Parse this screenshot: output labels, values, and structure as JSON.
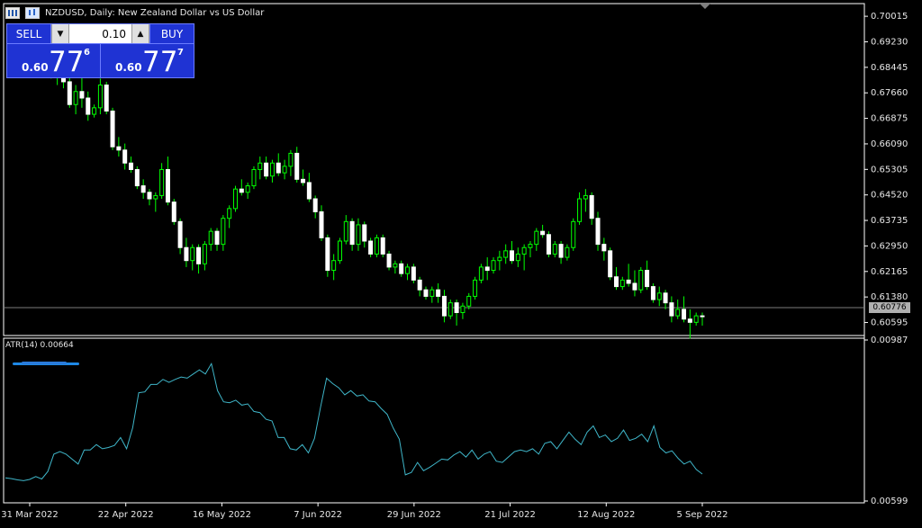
{
  "window": {
    "title": "NZDUSD, Daily:  New Zealand Dollar vs US Dollar",
    "icons": [
      "grid-icon",
      "ohlc-icon"
    ]
  },
  "trade_panel": {
    "sell_label": "SELL",
    "buy_label": "BUY",
    "lot_value": "0.10",
    "lot_down": "▼",
    "lot_up": "▲",
    "sell_price": {
      "prefix": "0.60",
      "main": "77",
      "sup": "6"
    },
    "buy_price": {
      "prefix": "0.60",
      "main": "77",
      "sup": "7"
    }
  },
  "indicator": {
    "label": "ATR(14) 0.00664",
    "axis_labels": [
      "0.00987",
      "0.00599"
    ]
  },
  "price_axis": {
    "labels": [
      "0.70015",
      "0.69230",
      "0.68445",
      "0.67660",
      "0.66875",
      "0.66090",
      "0.65305",
      "0.64520",
      "0.63735",
      "0.62950",
      "0.62165",
      "0.61380",
      "0.60595"
    ],
    "last_price": "0.60776"
  },
  "time_axis": {
    "labels": [
      "31 Mar 2022",
      "22 Apr 2022",
      "16 May 2022",
      "7 Jun 2022",
      "29 Jun 2022",
      "21 Jul 2022",
      "12 Aug 2022",
      "5 Sep 2022"
    ]
  },
  "colors": {
    "background": "#000000",
    "candle": "#00ff00",
    "grid": "#ffffff",
    "atr_line": "#3fb6c9",
    "panel_blue": "#1f33d3"
  },
  "chart_data": [
    {
      "type": "candlestick",
      "title": "NZDUSD, Daily:  New Zealand Dollar vs US Dollar",
      "ylim": [
        0.6025,
        0.7035
      ],
      "candles": [
        [
          0.69,
          0.693,
          0.684,
          0.687
        ],
        [
          0.687,
          0.69,
          0.681,
          0.684
        ],
        [
          0.684,
          0.687,
          0.679,
          0.682
        ],
        [
          0.682,
          0.686,
          0.678,
          0.68
        ],
        [
          0.68,
          0.682,
          0.672,
          0.673
        ],
        [
          0.673,
          0.679,
          0.67,
          0.677
        ],
        [
          0.677,
          0.683,
          0.672,
          0.675
        ],
        [
          0.675,
          0.677,
          0.668,
          0.67
        ],
        [
          0.67,
          0.673,
          0.669,
          0.672
        ],
        [
          0.672,
          0.681,
          0.67,
          0.679
        ],
        [
          0.679,
          0.68,
          0.67,
          0.671
        ],
        [
          0.671,
          0.672,
          0.659,
          0.66
        ],
        [
          0.66,
          0.663,
          0.657,
          0.659
        ],
        [
          0.659,
          0.661,
          0.653,
          0.655
        ],
        [
          0.655,
          0.657,
          0.652,
          0.653
        ],
        [
          0.653,
          0.654,
          0.647,
          0.648
        ],
        [
          0.648,
          0.65,
          0.644,
          0.646
        ],
        [
          0.646,
          0.647,
          0.642,
          0.644
        ],
        [
          0.644,
          0.646,
          0.64,
          0.645
        ],
        [
          0.645,
          0.655,
          0.644,
          0.653
        ],
        [
          0.653,
          0.657,
          0.642,
          0.643
        ],
        [
          0.643,
          0.644,
          0.636,
          0.637
        ],
        [
          0.637,
          0.638,
          0.627,
          0.629
        ],
        [
          0.629,
          0.632,
          0.623,
          0.625
        ],
        [
          0.625,
          0.63,
          0.622,
          0.629
        ],
        [
          0.629,
          0.63,
          0.621,
          0.624
        ],
        [
          0.624,
          0.631,
          0.622,
          0.63
        ],
        [
          0.63,
          0.635,
          0.628,
          0.634
        ],
        [
          0.634,
          0.635,
          0.628,
          0.63
        ],
        [
          0.63,
          0.639,
          0.628,
          0.638
        ],
        [
          0.638,
          0.642,
          0.635,
          0.641
        ],
        [
          0.641,
          0.648,
          0.64,
          0.647
        ],
        [
          0.647,
          0.65,
          0.645,
          0.646
        ],
        [
          0.646,
          0.649,
          0.644,
          0.648
        ],
        [
          0.648,
          0.654,
          0.647,
          0.653
        ],
        [
          0.653,
          0.657,
          0.65,
          0.655
        ],
        [
          0.655,
          0.657,
          0.65,
          0.651
        ],
        [
          0.651,
          0.656,
          0.649,
          0.655
        ],
        [
          0.655,
          0.658,
          0.651,
          0.652
        ],
        [
          0.652,
          0.656,
          0.65,
          0.654
        ],
        [
          0.654,
          0.659,
          0.651,
          0.658
        ],
        [
          0.658,
          0.66,
          0.649,
          0.65
        ],
        [
          0.65,
          0.653,
          0.648,
          0.649
        ],
        [
          0.649,
          0.652,
          0.643,
          0.644
        ],
        [
          0.644,
          0.645,
          0.638,
          0.64
        ],
        [
          0.64,
          0.642,
          0.631,
          0.632
        ],
        [
          0.632,
          0.633,
          0.62,
          0.622
        ],
        [
          0.622,
          0.627,
          0.619,
          0.625
        ],
        [
          0.625,
          0.632,
          0.624,
          0.631
        ],
        [
          0.631,
          0.639,
          0.63,
          0.637
        ],
        [
          0.637,
          0.638,
          0.628,
          0.63
        ],
        [
          0.63,
          0.638,
          0.628,
          0.636
        ],
        [
          0.636,
          0.637,
          0.629,
          0.631
        ],
        [
          0.631,
          0.632,
          0.626,
          0.627
        ],
        [
          0.627,
          0.633,
          0.626,
          0.632
        ],
        [
          0.632,
          0.633,
          0.626,
          0.627
        ],
        [
          0.627,
          0.628,
          0.622,
          0.623
        ],
        [
          0.623,
          0.625,
          0.621,
          0.624
        ],
        [
          0.624,
          0.625,
          0.62,
          0.621
        ],
        [
          0.621,
          0.624,
          0.619,
          0.623
        ],
        [
          0.623,
          0.624,
          0.618,
          0.619
        ],
        [
          0.619,
          0.62,
          0.614,
          0.616
        ],
        [
          0.616,
          0.617,
          0.613,
          0.614
        ],
        [
          0.614,
          0.617,
          0.612,
          0.616
        ],
        [
          0.616,
          0.618,
          0.612,
          0.614
        ],
        [
          0.614,
          0.616,
          0.606,
          0.608
        ],
        [
          0.608,
          0.613,
          0.607,
          0.612
        ],
        [
          0.612,
          0.613,
          0.605,
          0.609
        ],
        [
          0.609,
          0.612,
          0.607,
          0.611
        ],
        [
          0.611,
          0.615,
          0.61,
          0.614
        ],
        [
          0.614,
          0.62,
          0.613,
          0.619
        ],
        [
          0.619,
          0.624,
          0.618,
          0.623
        ],
        [
          0.623,
          0.626,
          0.619,
          0.622
        ],
        [
          0.622,
          0.626,
          0.621,
          0.625
        ],
        [
          0.625,
          0.628,
          0.622,
          0.626
        ],
        [
          0.626,
          0.63,
          0.624,
          0.628
        ],
        [
          0.628,
          0.631,
          0.624,
          0.625
        ],
        [
          0.625,
          0.629,
          0.623,
          0.627
        ],
        [
          0.627,
          0.63,
          0.622,
          0.629
        ],
        [
          0.629,
          0.631,
          0.626,
          0.63
        ],
        [
          0.63,
          0.635,
          0.628,
          0.634
        ],
        [
          0.634,
          0.636,
          0.632,
          0.633
        ],
        [
          0.633,
          0.634,
          0.626,
          0.627
        ],
        [
          0.627,
          0.631,
          0.626,
          0.63
        ],
        [
          0.63,
          0.631,
          0.624,
          0.626
        ],
        [
          0.626,
          0.63,
          0.625,
          0.629
        ],
        [
          0.629,
          0.638,
          0.628,
          0.637
        ],
        [
          0.637,
          0.646,
          0.636,
          0.644
        ],
        [
          0.644,
          0.647,
          0.64,
          0.645
        ],
        [
          0.645,
          0.646,
          0.636,
          0.638
        ],
        [
          0.638,
          0.64,
          0.628,
          0.63
        ],
        [
          0.63,
          0.632,
          0.625,
          0.628
        ],
        [
          0.628,
          0.629,
          0.619,
          0.62
        ],
        [
          0.62,
          0.623,
          0.616,
          0.617
        ],
        [
          0.617,
          0.62,
          0.616,
          0.619
        ],
        [
          0.619,
          0.624,
          0.617,
          0.618
        ],
        [
          0.618,
          0.622,
          0.614,
          0.616
        ],
        [
          0.616,
          0.623,
          0.615,
          0.622
        ],
        [
          0.622,
          0.625,
          0.616,
          0.617
        ],
        [
          0.617,
          0.618,
          0.612,
          0.613
        ],
        [
          0.613,
          0.617,
          0.611,
          0.615
        ],
        [
          0.615,
          0.616,
          0.61,
          0.612
        ],
        [
          0.612,
          0.614,
          0.606,
          0.608
        ],
        [
          0.608,
          0.613,
          0.607,
          0.61
        ],
        [
          0.61,
          0.614,
          0.606,
          0.607
        ],
        [
          0.607,
          0.61,
          0.601,
          0.606
        ],
        [
          0.606,
          0.609,
          0.605,
          0.608
        ],
        [
          0.608,
          0.609,
          0.605,
          0.6078
        ]
      ]
    },
    {
      "type": "line",
      "title": "ATR(14) 0.00664",
      "ylim": [
        0.00599,
        0.00987
      ],
      "series": [
        {
          "values": [
            0.00655,
            0.00653,
            0.0065,
            0.00648,
            0.00651,
            0.00658,
            0.00652,
            0.0067,
            0.00712,
            0.00718,
            0.00712,
            0.007,
            0.00688,
            0.00722,
            0.00722,
            0.00735,
            0.00725,
            0.00728,
            0.00733,
            0.00752,
            0.00725,
            0.00775,
            0.0086,
            0.00862,
            0.0088,
            0.0088,
            0.00892,
            0.00885,
            0.00892,
            0.00898,
            0.00895,
            0.00905,
            0.00915,
            0.00905,
            0.0093,
            0.00865,
            0.00838,
            0.00836,
            0.00842,
            0.0083,
            0.00833,
            0.00815,
            0.00812,
            0.00796,
            0.00792,
            0.00752,
            0.00752,
            0.00725,
            0.00722,
            0.00735,
            0.00715,
            0.0075,
            0.00825,
            0.00895,
            0.00882,
            0.00872,
            0.00855,
            0.00865,
            0.00852,
            0.00855,
            0.0084,
            0.00838,
            0.00822,
            0.00808,
            0.00775,
            0.00748,
            0.00662,
            0.00668,
            0.00692,
            0.00672,
            0.0068,
            0.0069,
            0.007,
            0.00698,
            0.0071,
            0.00718,
            0.00705,
            0.00722,
            0.007,
            0.00712,
            0.00718,
            0.00695,
            0.00692,
            0.00705,
            0.00718,
            0.00722,
            0.00718,
            0.00725,
            0.00712,
            0.00738,
            0.00742,
            0.00725,
            0.00745,
            0.00765,
            0.00748,
            0.00735,
            0.00765,
            0.0078,
            0.00752,
            0.00758,
            0.00742,
            0.0075,
            0.0077,
            0.00745,
            0.0075,
            0.0076,
            0.00742,
            0.0078,
            0.00728,
            0.00715,
            0.0072,
            0.00702,
            0.00688,
            0.00695,
            0.00675,
            0.00664
          ]
        }
      ]
    }
  ]
}
